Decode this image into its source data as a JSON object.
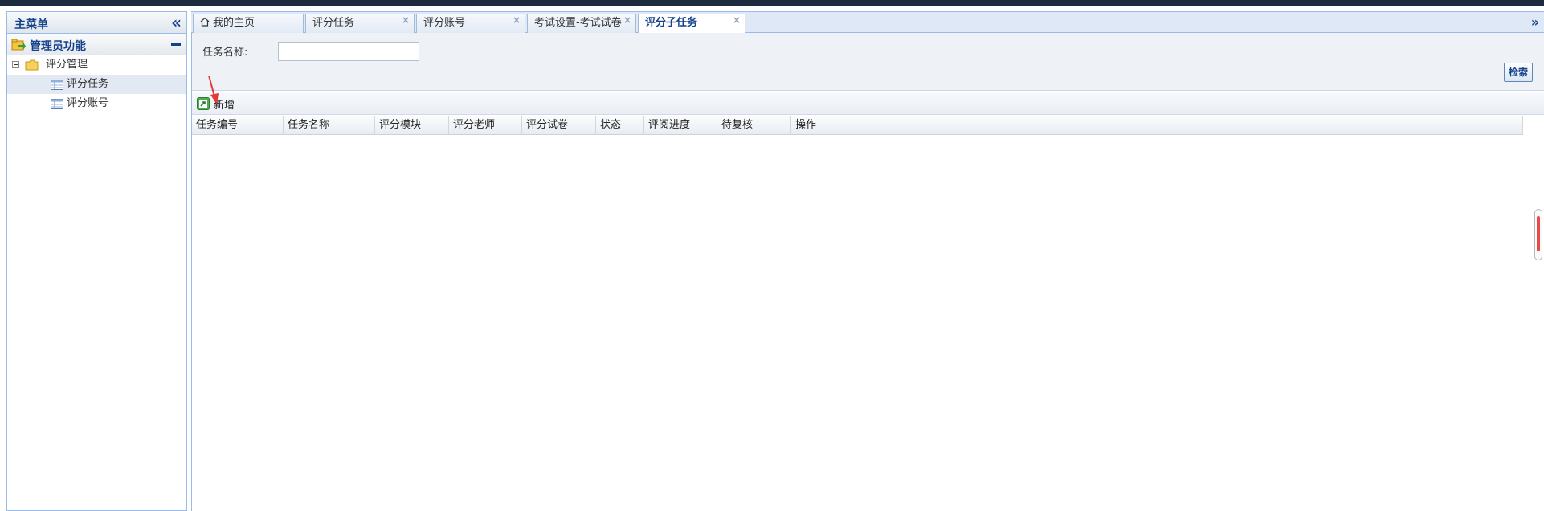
{
  "sidebar": {
    "title": "主菜单",
    "group_label": "管理员功能",
    "tree": {
      "root_label": "评分管理",
      "items": [
        {
          "label": "评分任务",
          "selected": true
        },
        {
          "label": "评分账号",
          "selected": false
        }
      ]
    }
  },
  "tabs": [
    {
      "label": "我的主页",
      "icon": "home-icon",
      "closable": false,
      "active": false
    },
    {
      "label": "评分任务",
      "closable": true,
      "active": false
    },
    {
      "label": "评分账号",
      "closable": true,
      "active": false
    },
    {
      "label": "考试设置-考试试卷",
      "closable": true,
      "active": false
    },
    {
      "label": "评分子任务",
      "closable": true,
      "active": true
    }
  ],
  "tab_close_glyph": "×",
  "search": {
    "label": "任务名称:",
    "value": "",
    "button_label": "检索"
  },
  "toolbar": {
    "add_label": "新增"
  },
  "grid": {
    "columns": [
      "任务编号",
      "任务名称",
      "评分模块",
      "评分老师",
      "评分试卷",
      "状态",
      "评阅进度",
      "待复核",
      "操作"
    ],
    "rows": []
  },
  "colors": {
    "header_text": "#15428b",
    "border": "#99bbe8",
    "annotation_arrow": "#e53935"
  }
}
